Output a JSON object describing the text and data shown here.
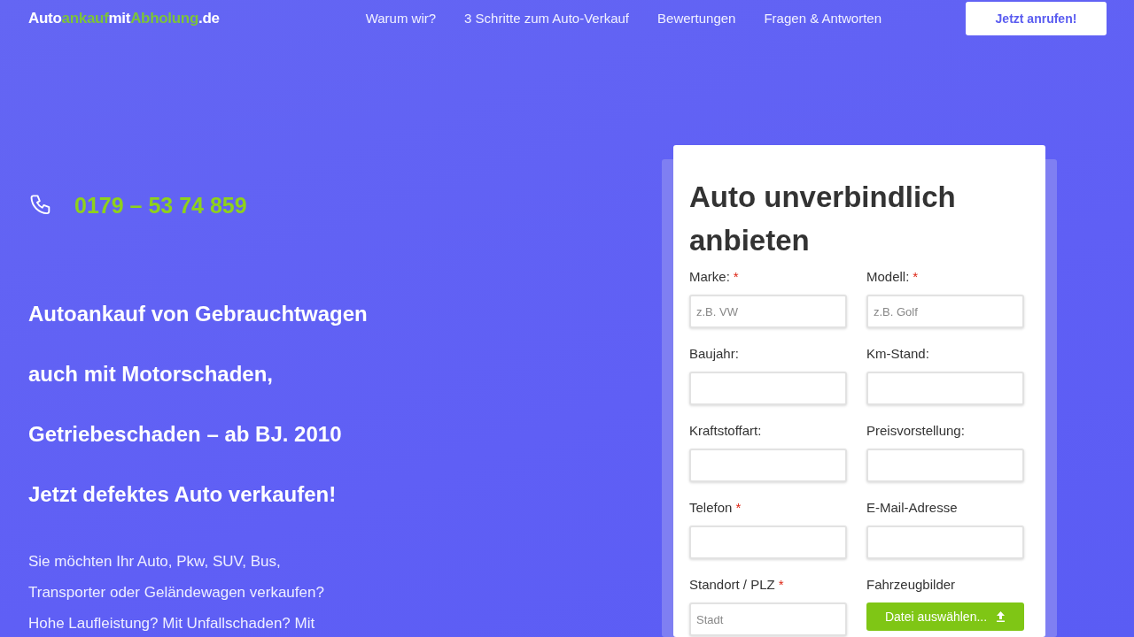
{
  "logo": [
    {
      "text": "Auto",
      "accent": false
    },
    {
      "text": "ankauf",
      "accent": true
    },
    {
      "text": "mit",
      "accent": false
    },
    {
      "text": "Abholung",
      "accent": true
    },
    {
      "text": ".de",
      "accent": false
    }
  ],
  "nav": [
    "Warum wir?",
    "3 Schritte zum Auto-Verkauf",
    "Bewertungen",
    "Fragen & Antworten"
  ],
  "call_button": "Jetzt anrufen!",
  "phone": "0179 – 53 74 859",
  "headlines": [
    "Autoankauf von Gebrauchtwagen",
    "auch mit Motorschaden,",
    "Getriebeschaden – ab BJ. 2010",
    "Jetzt defektes Auto verkaufen!"
  ],
  "intro_lines": [
    "Sie möchten Ihr Auto, Pkw, SUV, Bus,",
    "Transporter oder Geländewagen verkaufen?",
    "Hohe Laufleistung? Mit Unfallschaden? Mit"
  ],
  "form": {
    "title": "Auto unverbindlich anbieten",
    "fields": [
      {
        "label": "Marke:",
        "required_mark": "*",
        "kind": "input",
        "placeholder": "z.B. VW"
      },
      {
        "label": "Modell:",
        "required_mark": "*",
        "kind": "input",
        "placeholder": "z.B. Golf"
      },
      {
        "label": "Baujahr:",
        "kind": "input"
      },
      {
        "label": "Km-Stand:",
        "kind": "input"
      },
      {
        "label": "Kraftstoffart:",
        "kind": "input"
      },
      {
        "label": "Preisvorstellung:",
        "kind": "input"
      },
      {
        "label": "Telefon",
        "required_mark": "*",
        "kind": "input"
      },
      {
        "label": "E-Mail-Adresse",
        "kind": "input"
      },
      {
        "label": "Standort / PLZ",
        "required_mark": "*",
        "kind": "input",
        "placeholder": "Stadt"
      },
      {
        "label": "Fahrzeugbilder",
        "kind": "file",
        "button": "Datei auswählen..."
      }
    ]
  }
}
